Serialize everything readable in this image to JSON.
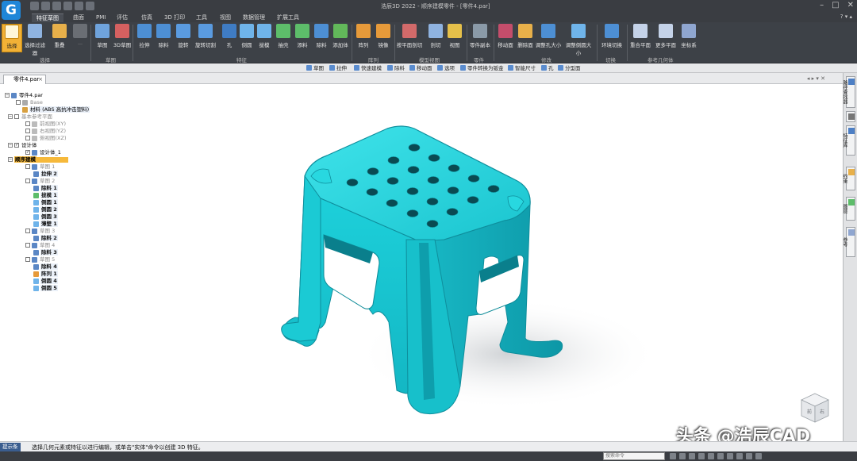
{
  "app": {
    "title": "浩辰3D 2022 - 顺序建模零件 - [零件4.par]",
    "logo_letter": "G"
  },
  "tabs": [
    "特征草图",
    "曲面",
    "PMI",
    "评估",
    "仿真",
    "3D 打印",
    "工具",
    "视图",
    "数据管理",
    "扩展工具"
  ],
  "active_tab": 0,
  "ribbon": {
    "buttons": [
      "选择",
      "选择过滤器",
      "重叠",
      "草图",
      "3D草图",
      "拉伸",
      "除料",
      "旋转",
      "旋转切割",
      "孔",
      "倒圆",
      "拔模",
      "抽壳",
      "添料",
      "除料",
      "添加体",
      "阵列",
      "镜像",
      "按平面剖切",
      "剖切",
      "视图",
      "零件副本",
      "移动面",
      "删除面",
      "调整孔大小",
      "调整倒圆大小",
      "环境切换",
      "重合平面",
      "更多平面",
      "坐标系"
    ],
    "groups": [
      "选择",
      "草图",
      "特征",
      "阵列",
      "模型视图",
      "零件",
      "修改",
      "切换",
      "参考几何体"
    ]
  },
  "command_bar": [
    "草图",
    "拉伸",
    "快速建模",
    "除料",
    "移动面",
    "选项",
    "零件转换为钣金",
    "智能尺寸",
    "孔",
    "分型面"
  ],
  "document_tab": {
    "label": "零件4.par"
  },
  "tree": [
    {
      "label": "零件4.par",
      "style": "bold"
    },
    {
      "label": "Base",
      "style": "gray"
    },
    {
      "label": "材料 (ABS 高抗冲击塑料)",
      "style": "normal"
    },
    {
      "label": "基本参考平面",
      "style": "gray"
    },
    {
      "label": "前视图(XY)",
      "style": "gray"
    },
    {
      "label": "右视图(YZ)",
      "style": "gray"
    },
    {
      "label": "俯视图(XZ)",
      "style": "gray"
    },
    {
      "label": "设计体",
      "style": "normal"
    },
    {
      "label": "设计体_1",
      "style": "normal"
    },
    {
      "label": "顺序建模",
      "style": "hl"
    },
    {
      "label": "草图 1",
      "style": "gray"
    },
    {
      "label": "拉伸 2",
      "style": "bold"
    },
    {
      "label": "草图 2",
      "style": "gray"
    },
    {
      "label": "除料 1",
      "style": "bold"
    },
    {
      "label": "拔模 1",
      "style": "bold"
    },
    {
      "label": "倒圆 1",
      "style": "bold"
    },
    {
      "label": "倒圆 2",
      "style": "bold"
    },
    {
      "label": "倒圆 3",
      "style": "bold"
    },
    {
      "label": "薄壁 1",
      "style": "bold"
    },
    {
      "label": "草图 3",
      "style": "gray"
    },
    {
      "label": "除料 2",
      "style": "bold"
    },
    {
      "label": "草图 4",
      "style": "gray"
    },
    {
      "label": "除料 3",
      "style": "bold"
    },
    {
      "label": "草图 5",
      "style": "gray"
    },
    {
      "label": "除料 4",
      "style": "bold"
    },
    {
      "label": "阵列 1",
      "style": "bold"
    },
    {
      "label": "倒圆 4",
      "style": "bold"
    },
    {
      "label": "倒圆 5",
      "style": "bold"
    }
  ],
  "sidebar": [
    "路径查找器",
    "帮助",
    "特征库",
    "约束",
    "图层",
    "参考"
  ],
  "status": {
    "badge": "提示条",
    "text": "选择几何元素或特征以进行编辑，或单击\"实体\"命令以创建 3D 特征。"
  },
  "search": {
    "placeholder": "搜索命令"
  },
  "watermark": "头条 @浩辰CAD",
  "viewcube": {
    "front": "前",
    "right": "右"
  },
  "colors": {
    "model": "#1fc6d0",
    "model_dark": "#0f9aa8",
    "highlight": "#f6b93b"
  }
}
